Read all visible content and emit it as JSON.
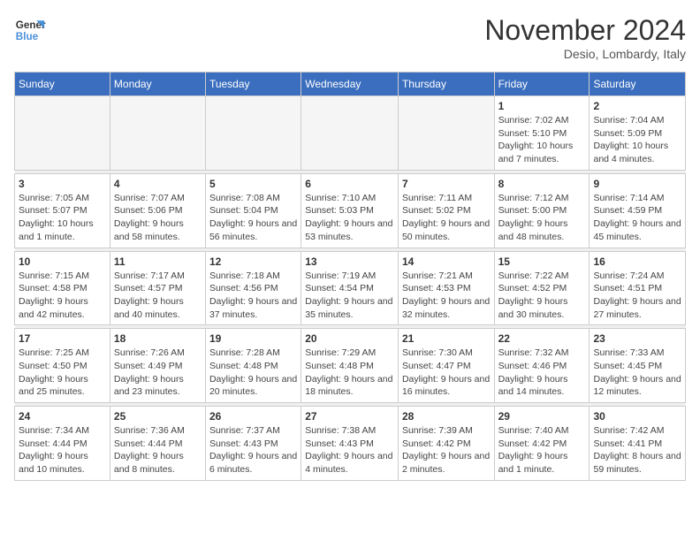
{
  "header": {
    "logo_general": "General",
    "logo_blue": "Blue",
    "month_title": "November 2024",
    "location": "Desio, Lombardy, Italy"
  },
  "weekdays": [
    "Sunday",
    "Monday",
    "Tuesday",
    "Wednesday",
    "Thursday",
    "Friday",
    "Saturday"
  ],
  "weeks": [
    [
      {
        "day": "",
        "info": ""
      },
      {
        "day": "",
        "info": ""
      },
      {
        "day": "",
        "info": ""
      },
      {
        "day": "",
        "info": ""
      },
      {
        "day": "",
        "info": ""
      },
      {
        "day": "1",
        "info": "Sunrise: 7:02 AM\nSunset: 5:10 PM\nDaylight: 10 hours and 7 minutes."
      },
      {
        "day": "2",
        "info": "Sunrise: 7:04 AM\nSunset: 5:09 PM\nDaylight: 10 hours and 4 minutes."
      }
    ],
    [
      {
        "day": "3",
        "info": "Sunrise: 7:05 AM\nSunset: 5:07 PM\nDaylight: 10 hours and 1 minute."
      },
      {
        "day": "4",
        "info": "Sunrise: 7:07 AM\nSunset: 5:06 PM\nDaylight: 9 hours and 58 minutes."
      },
      {
        "day": "5",
        "info": "Sunrise: 7:08 AM\nSunset: 5:04 PM\nDaylight: 9 hours and 56 minutes."
      },
      {
        "day": "6",
        "info": "Sunrise: 7:10 AM\nSunset: 5:03 PM\nDaylight: 9 hours and 53 minutes."
      },
      {
        "day": "7",
        "info": "Sunrise: 7:11 AM\nSunset: 5:02 PM\nDaylight: 9 hours and 50 minutes."
      },
      {
        "day": "8",
        "info": "Sunrise: 7:12 AM\nSunset: 5:00 PM\nDaylight: 9 hours and 48 minutes."
      },
      {
        "day": "9",
        "info": "Sunrise: 7:14 AM\nSunset: 4:59 PM\nDaylight: 9 hours and 45 minutes."
      }
    ],
    [
      {
        "day": "10",
        "info": "Sunrise: 7:15 AM\nSunset: 4:58 PM\nDaylight: 9 hours and 42 minutes."
      },
      {
        "day": "11",
        "info": "Sunrise: 7:17 AM\nSunset: 4:57 PM\nDaylight: 9 hours and 40 minutes."
      },
      {
        "day": "12",
        "info": "Sunrise: 7:18 AM\nSunset: 4:56 PM\nDaylight: 9 hours and 37 minutes."
      },
      {
        "day": "13",
        "info": "Sunrise: 7:19 AM\nSunset: 4:54 PM\nDaylight: 9 hours and 35 minutes."
      },
      {
        "day": "14",
        "info": "Sunrise: 7:21 AM\nSunset: 4:53 PM\nDaylight: 9 hours and 32 minutes."
      },
      {
        "day": "15",
        "info": "Sunrise: 7:22 AM\nSunset: 4:52 PM\nDaylight: 9 hours and 30 minutes."
      },
      {
        "day": "16",
        "info": "Sunrise: 7:24 AM\nSunset: 4:51 PM\nDaylight: 9 hours and 27 minutes."
      }
    ],
    [
      {
        "day": "17",
        "info": "Sunrise: 7:25 AM\nSunset: 4:50 PM\nDaylight: 9 hours and 25 minutes."
      },
      {
        "day": "18",
        "info": "Sunrise: 7:26 AM\nSunset: 4:49 PM\nDaylight: 9 hours and 23 minutes."
      },
      {
        "day": "19",
        "info": "Sunrise: 7:28 AM\nSunset: 4:48 PM\nDaylight: 9 hours and 20 minutes."
      },
      {
        "day": "20",
        "info": "Sunrise: 7:29 AM\nSunset: 4:48 PM\nDaylight: 9 hours and 18 minutes."
      },
      {
        "day": "21",
        "info": "Sunrise: 7:30 AM\nSunset: 4:47 PM\nDaylight: 9 hours and 16 minutes."
      },
      {
        "day": "22",
        "info": "Sunrise: 7:32 AM\nSunset: 4:46 PM\nDaylight: 9 hours and 14 minutes."
      },
      {
        "day": "23",
        "info": "Sunrise: 7:33 AM\nSunset: 4:45 PM\nDaylight: 9 hours and 12 minutes."
      }
    ],
    [
      {
        "day": "24",
        "info": "Sunrise: 7:34 AM\nSunset: 4:44 PM\nDaylight: 9 hours and 10 minutes."
      },
      {
        "day": "25",
        "info": "Sunrise: 7:36 AM\nSunset: 4:44 PM\nDaylight: 9 hours and 8 minutes."
      },
      {
        "day": "26",
        "info": "Sunrise: 7:37 AM\nSunset: 4:43 PM\nDaylight: 9 hours and 6 minutes."
      },
      {
        "day": "27",
        "info": "Sunrise: 7:38 AM\nSunset: 4:43 PM\nDaylight: 9 hours and 4 minutes."
      },
      {
        "day": "28",
        "info": "Sunrise: 7:39 AM\nSunset: 4:42 PM\nDaylight: 9 hours and 2 minutes."
      },
      {
        "day": "29",
        "info": "Sunrise: 7:40 AM\nSunset: 4:42 PM\nDaylight: 9 hours and 1 minute."
      },
      {
        "day": "30",
        "info": "Sunrise: 7:42 AM\nSunset: 4:41 PM\nDaylight: 8 hours and 59 minutes."
      }
    ]
  ]
}
